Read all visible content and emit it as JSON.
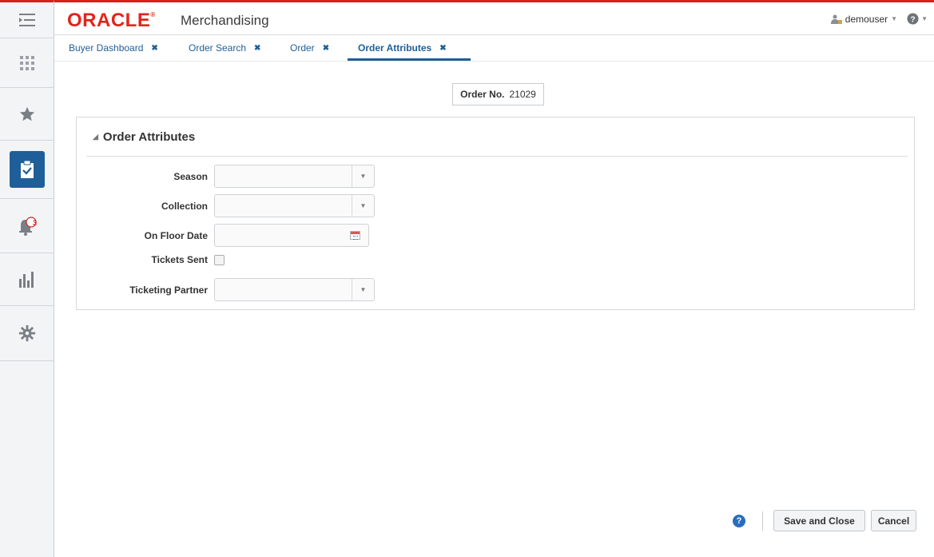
{
  "header": {
    "logo_text": "ORACLE",
    "logo_mark": "®",
    "app_name": "Merchandising",
    "username": "demouser"
  },
  "rail": {
    "notifications_count": "3"
  },
  "tabs": [
    {
      "label": "Buyer Dashboard",
      "close": "✖"
    },
    {
      "label": "Order Search",
      "close": "✖"
    },
    {
      "label": "Order",
      "close": "✖"
    },
    {
      "label": "Order Attributes",
      "close": "✖",
      "active": true
    }
  ],
  "order": {
    "label": "Order No.",
    "value": "21029"
  },
  "panel": {
    "title": "Order Attributes",
    "fields": {
      "season": {
        "label": "Season",
        "value": ""
      },
      "collection": {
        "label": "Collection",
        "value": ""
      },
      "on_floor_date": {
        "label": "On Floor Date",
        "value": ""
      },
      "tickets_sent": {
        "label": "Tickets Sent",
        "checked": false
      },
      "ticketing_partner": {
        "label": "Ticketing Partner",
        "value": ""
      }
    }
  },
  "footer": {
    "help_glyph": "?",
    "save_close_label": "Save and Close",
    "cancel_label": "Cancel"
  },
  "colors": {
    "brand_red": "#e1251b",
    "accent_blue": "#1e5f99"
  }
}
